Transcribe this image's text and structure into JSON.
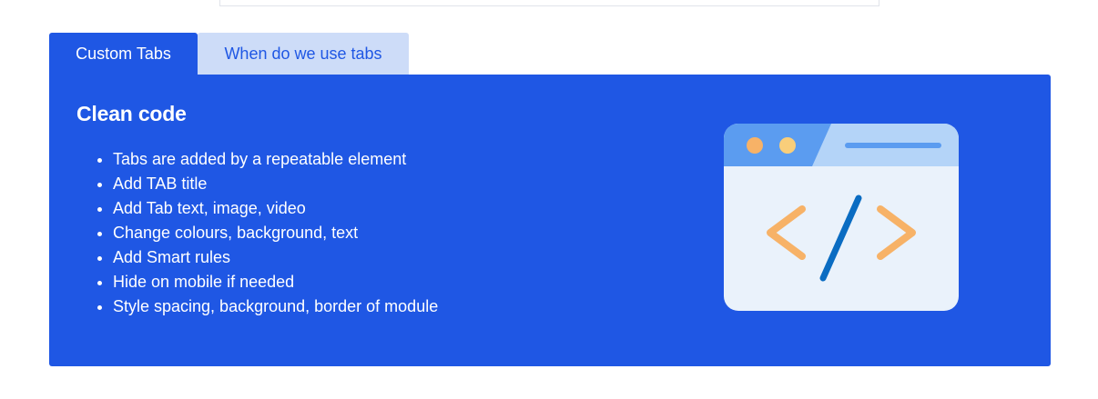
{
  "tabs": [
    {
      "label": "Custom Tabs",
      "active": true
    },
    {
      "label": "When do we use tabs",
      "active": false
    }
  ],
  "panel": {
    "title": "Clean code",
    "items": [
      "Tabs are added by a repeatable element",
      "Add TAB title",
      "Add Tab text, image, video",
      "Change colours, background, text",
      "Add Smart rules",
      "Hide on mobile if needed",
      "Style spacing, background, border of module"
    ],
    "illustration_icon": "code-window-icon"
  },
  "colors": {
    "accent": "#1f57e4",
    "tab_inactive_bg": "#cddcf8",
    "window_body": "#eaf2fb",
    "window_bar": "#5b9cf0",
    "window_bar_light": "#b4d4f8",
    "dot_1": "#f7b267",
    "dot_2": "#f9ce7a",
    "bracket": "#f7b267",
    "slash": "#0a6cc2"
  }
}
